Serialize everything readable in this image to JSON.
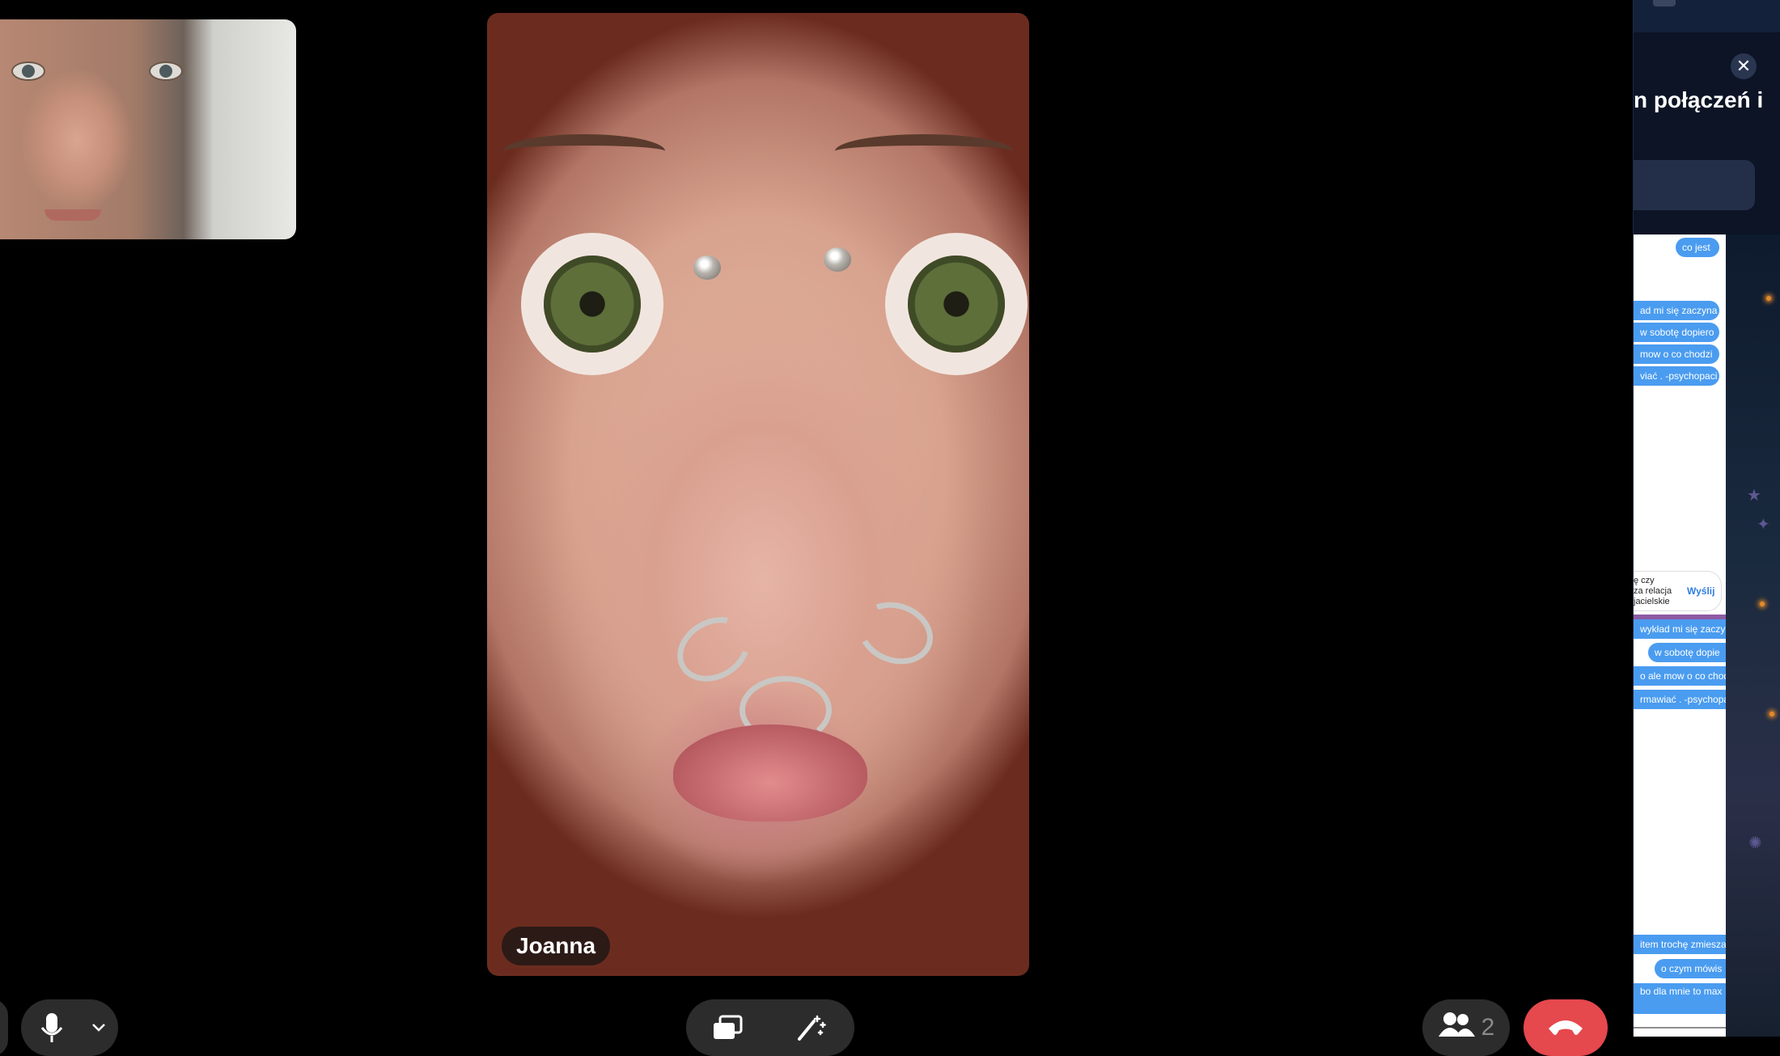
{
  "call": {
    "remote_participant_name": "Joanna",
    "participant_count": "2"
  },
  "icons": {
    "mic": "microphone-icon",
    "chevron": "chevron-down-icon",
    "share": "screen-share-icon",
    "effects": "effects-icon",
    "participants": "people-icon",
    "end_call": "phone-hangup-icon",
    "close": "close-icon"
  },
  "colors": {
    "end_call": "#e5484d",
    "control_bg": "#2c2c2c",
    "chat_bubble": "#4a9cf0",
    "send_link": "#2f7ee0"
  },
  "side_panel": {
    "close_label": "✕",
    "heading": "n połączeń i",
    "messages_upper": [
      "co jest",
      "ad mi się zaczyna",
      "w sobotę dopiero",
      "mow o co chodzi",
      "viać . -psychopaci"
    ],
    "composer_text": "ę czy\nza relacja\njacielskie",
    "send_label": "Wyślij",
    "messages_lower": [
      "wykład mi się zaczy",
      "w sobotę dopie",
      "o ale mow o co chod",
      "rmawiać . -psychopa"
    ],
    "messages_bottom": [
      "item trochę zmiesza",
      "o czym mówis",
      "bo dla mnie to max"
    ]
  }
}
